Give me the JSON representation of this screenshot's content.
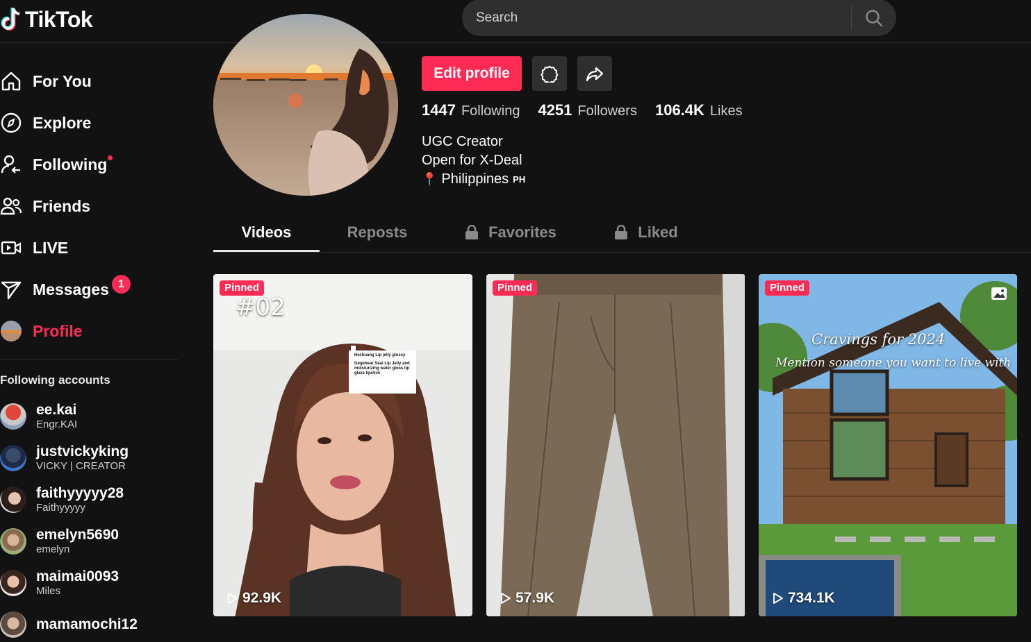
{
  "header": {
    "logo_text": "TikTok",
    "search_placeholder": "Search"
  },
  "sidebar": {
    "nav": [
      {
        "label": "For You",
        "icon": "home-icon"
      },
      {
        "label": "Explore",
        "icon": "compass-icon"
      },
      {
        "label": "Following",
        "icon": "following-icon",
        "dot": true
      },
      {
        "label": "Friends",
        "icon": "friends-icon"
      },
      {
        "label": "LIVE",
        "icon": "live-icon"
      },
      {
        "label": "Messages",
        "icon": "messages-icon",
        "badge": "1"
      },
      {
        "label": "Profile",
        "icon": "profile-avatar",
        "active": true
      }
    ],
    "following_title": "Following accounts",
    "accounts": [
      {
        "name": "ee.kai",
        "sub": "Engr.KAI"
      },
      {
        "name": "justvickyking",
        "sub": "VICKY | CREATOR"
      },
      {
        "name": "faithyyyyy28",
        "sub": "Faithyyyyy"
      },
      {
        "name": "emelyn5690",
        "sub": "emelyn"
      },
      {
        "name": "maimai0093",
        "sub": "Miles"
      },
      {
        "name": "mamamochi12",
        "sub": ""
      }
    ]
  },
  "profile": {
    "edit_label": "Edit profile",
    "stats": [
      {
        "num": "1447",
        "label": "Following"
      },
      {
        "num": "4251",
        "label": "Followers"
      },
      {
        "num": "106.4K",
        "label": "Likes"
      }
    ],
    "bio": [
      "UGC Creator",
      "Open for X-Deal"
    ],
    "location": "Philippines",
    "country_code": "PH"
  },
  "tabs": [
    {
      "label": "Videos",
      "active": true,
      "locked": false
    },
    {
      "label": "Reposts",
      "active": false,
      "locked": false
    },
    {
      "label": "Favorites",
      "active": false,
      "locked": true
    },
    {
      "label": "Liked",
      "active": false,
      "locked": true
    }
  ],
  "videos": [
    {
      "pinned": "Pinned",
      "views": "92.9K",
      "overlay": "#02",
      "sticker_title": "Hezhuang Lip jelly glossy",
      "sticker_body": "Gegebear Seal Lip Jelly and moisturizing water gloss lip glaze lipstick"
    },
    {
      "pinned": "Pinned",
      "views": "57.9K"
    },
    {
      "pinned": "Pinned",
      "views": "734.1K",
      "overlay_title": "Cravings for 2024",
      "overlay_sub": "Mention someone you want to live with"
    }
  ],
  "colors": {
    "accent": "#fe2c55",
    "background": "#121212",
    "surface": "#2f2f2f"
  }
}
